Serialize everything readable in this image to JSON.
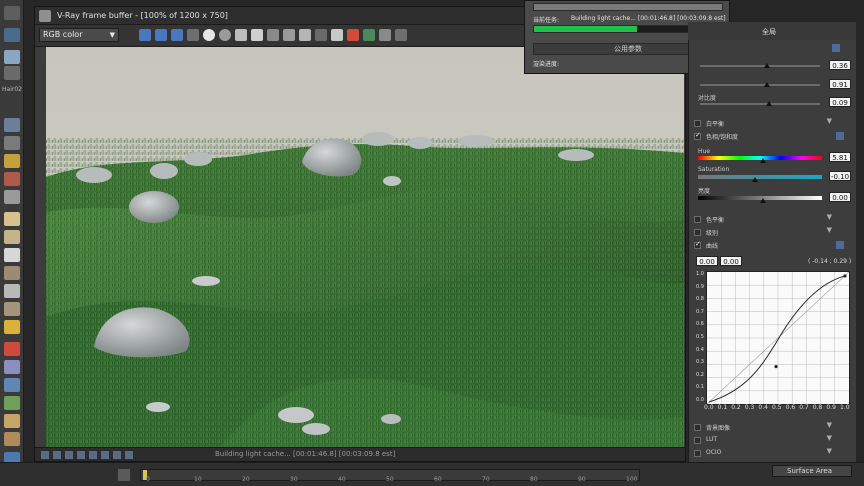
{
  "app": {
    "left_label": "Hair02"
  },
  "vfb": {
    "title": "V-Ray frame buffer - [100% of 1200 x 750]",
    "channel_select": "RGB color",
    "status_text": "Building light cache... [00:01:46.8] [00:03:09.8 est]"
  },
  "progress": {
    "task_label": "当前任务:",
    "task_value": "Building light cache...  [00:01:46.8]  [00:03:09.8 est]",
    "progress_fraction": 0.55,
    "section_label": "公用参数",
    "render_progress_label": "渲染进度:"
  },
  "cc_panel": {
    "top_label": "全局",
    "values": {
      "exposure": "0.36",
      "contrast_a": "0.91",
      "contrast_b": "0.09",
      "hue": "5.81",
      "saturation": "-0.10",
      "lightness": "0.00",
      "curve_x": "0.00",
      "curve_y": "0.00",
      "curve_readout": "( -0.14 ; 0.29 )"
    },
    "labels": {
      "contrast_b": "对比度",
      "white_balance": "白平衡",
      "hue_sat": "色相/饱和度",
      "hue": "Hue",
      "saturation": "Saturation",
      "lightness": "亮度",
      "color_balance": "色平衡",
      "levels": "级别",
      "curves": "曲线",
      "bg_image": "背景图像",
      "lut": "LUT",
      "ocio": "OCIO"
    },
    "curve_ticks": [
      "0.0",
      "0.1",
      "0.2",
      "0.3",
      "0.4",
      "0.5",
      "0.6",
      "0.7",
      "0.8",
      "0.9",
      "1.0"
    ],
    "curve_y_ticks": [
      "1.0",
      "0.9",
      "0.8",
      "0.7",
      "0.6",
      "0.5",
      "0.4",
      "0.3",
      "0.2",
      "0.1",
      "0.0"
    ]
  },
  "timeline": {
    "ticks": [
      "0",
      "10",
      "20",
      "30",
      "40",
      "50",
      "60",
      "70",
      "80",
      "90",
      "100"
    ],
    "surface_label": "Surface Area"
  }
}
